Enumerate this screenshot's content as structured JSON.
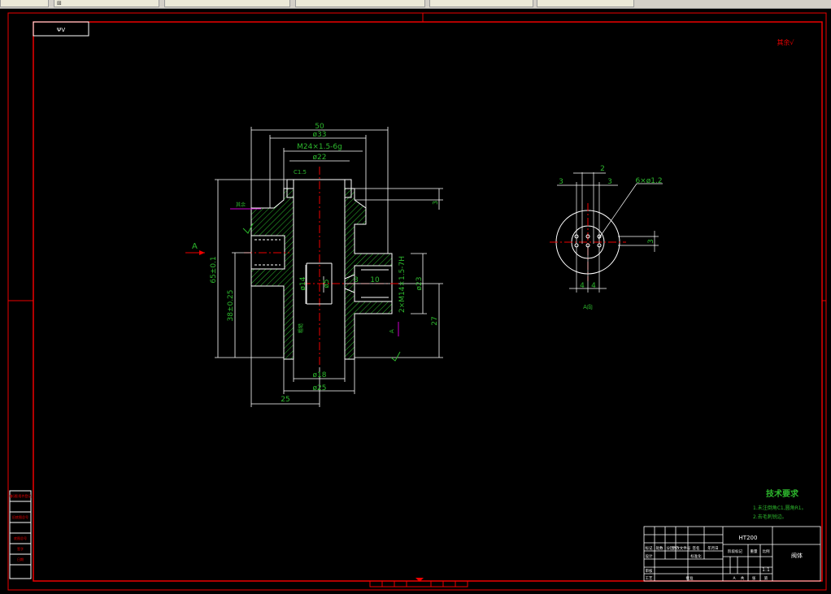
{
  "app": {
    "tabs": [
      {
        "label": ""
      },
      {
        "label": "⊞"
      },
      {
        "label": ""
      },
      {
        "label": ""
      },
      {
        "label": ""
      },
      {
        "label": ""
      }
    ]
  },
  "sheet": {
    "corner_label": "ΨV",
    "roughness_note": "其余√"
  },
  "main_view": {
    "dims": {
      "d50": "50",
      "d33": "ø33",
      "thread_top": "M24×1.5-6g",
      "d22": "ø22",
      "c15": "C1.5",
      "h3_top": "3",
      "h65": "65±0.1",
      "h38": "38±0.25",
      "d14": "ø14",
      "d5": "ø5",
      "l3": "3",
      "l10": "10",
      "thread_side": "2×M14×1.5-7H",
      "d23": "ø23",
      "h27": "27",
      "d18": "ø18",
      "d25": "ø25",
      "l25": "25",
      "view_arrow": "A",
      "view_arrow_right": "A",
      "roughness_1": "其余",
      "roughness_2": "粗糙"
    }
  },
  "aux_view": {
    "dims": {
      "d3_left": "3",
      "d2": "2",
      "d3_right": "3",
      "holes": "6×ø1.2",
      "d3_side": "3",
      "d4_a": "4",
      "d4_b": "4"
    },
    "caption": "A向"
  },
  "tech_req": {
    "title": "技术要求",
    "line1": "1.未注倒角C1,圆角R1。",
    "line2": "2.去毛刺锐边。"
  },
  "title_block": {
    "material": "HT200",
    "part_name": "阀体",
    "rows": [
      "标记",
      "处数",
      "分区",
      "更改文件号",
      "签名",
      "年月日"
    ],
    "labels": [
      "设计",
      "标准化",
      "阶段标记",
      "重量",
      "比例",
      "审核",
      "工艺",
      "批准"
    ],
    "scale": "1:1",
    "sheet_codes": [
      "A",
      "共",
      "张",
      "第"
    ]
  },
  "left_strip": {
    "labels": [
      "借(通)用件登记",
      "旧底图总号",
      "底图总号",
      "签字",
      "日期"
    ]
  }
}
